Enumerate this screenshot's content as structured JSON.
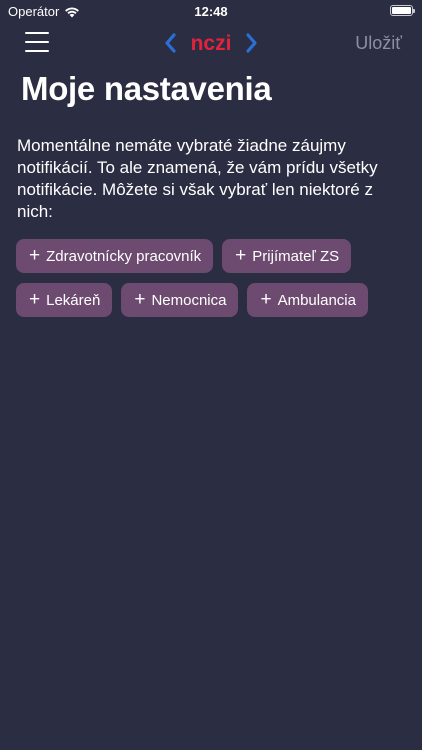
{
  "status_bar": {
    "carrier": "Operátor",
    "time": "12:48",
    "wifi_icon": "wifi-icon",
    "battery_icon": "battery-full-icon"
  },
  "nav": {
    "menu_icon": "hamburger-menu-icon",
    "logo_text": "nczi",
    "save_label": "Uložiť"
  },
  "page": {
    "title": "Moje nastavenia",
    "intro": "Momentálne nemáte vybraté žiadne záujmy notifikácií. To ale znamená, že vám prídu všetky notifikácie. Môžete si však vybrať len niektoré z nich:"
  },
  "chips": [
    {
      "label": "Zdravotnícky pracovník",
      "icon": "plus-icon"
    },
    {
      "label": "Prijímateľ ZS",
      "icon": "plus-icon"
    },
    {
      "label": "Lekáreň",
      "icon": "plus-icon"
    },
    {
      "label": "Nemocnica",
      "icon": "plus-icon"
    },
    {
      "label": "Ambulancia",
      "icon": "plus-icon"
    }
  ],
  "colors": {
    "background": "#2b2d42",
    "chip": "#6d4a70",
    "logo_red": "#e2233b",
    "logo_blue": "#2a6fd6",
    "save_disabled": "#8d8fa3"
  }
}
